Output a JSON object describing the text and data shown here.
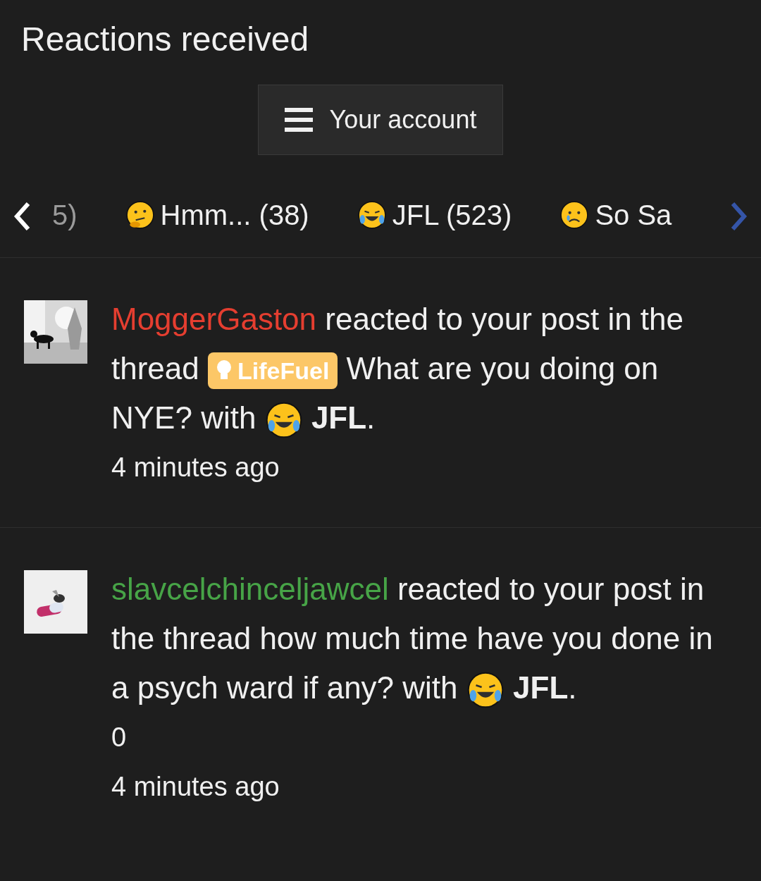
{
  "page_title": "Reactions received",
  "account_button": {
    "label": "Your account"
  },
  "reaction_tabs": [
    {
      "label": "5)",
      "kind": "none",
      "selected": false
    },
    {
      "label": "Hmm... (38)",
      "kind": "thinking",
      "selected": false
    },
    {
      "label": "JFL (523)",
      "kind": "laughing",
      "selected": false
    },
    {
      "label": "So Sa",
      "kind": "sad",
      "selected": false
    }
  ],
  "alerts": [
    {
      "username": "MoggerGaston",
      "color": "#e53e30",
      "message": "reacted to your post in the thread",
      "prefix": "LifeFuel",
      "thread_title": "What are you doing on NYE?",
      "with": "with",
      "reaction": {
        "kind": "laughing",
        "label": "JFL"
      },
      "end": ".",
      "time": "4 minutes ago"
    },
    {
      "username": "slavcelchinceljawcel",
      "color": "#47a447",
      "message": "reacted to your post in the thread",
      "thread_title": "how much time have you done in a psych ward if any?",
      "with": "with",
      "reaction": {
        "kind": "laughing",
        "label": "JFL"
      },
      "end": ".",
      "extra": "0",
      "time": "4 minutes ago"
    }
  ]
}
